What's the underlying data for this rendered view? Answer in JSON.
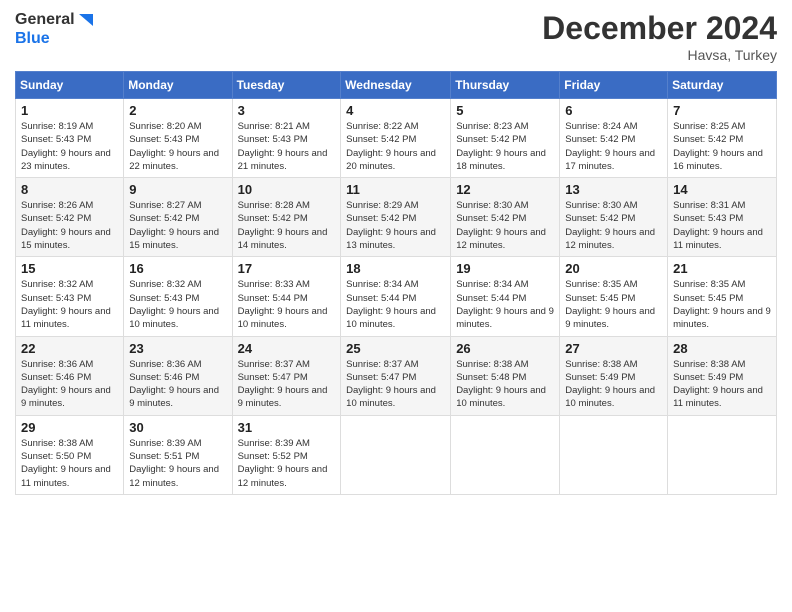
{
  "logo": {
    "line1": "General",
    "line2": "Blue"
  },
  "title": "December 2024",
  "location": "Havsa, Turkey",
  "days_header": [
    "Sunday",
    "Monday",
    "Tuesday",
    "Wednesday",
    "Thursday",
    "Friday",
    "Saturday"
  ],
  "weeks": [
    [
      {
        "day": "1",
        "sunrise": "8:19 AM",
        "sunset": "5:43 PM",
        "daylight": "9 hours and 23 minutes."
      },
      {
        "day": "2",
        "sunrise": "8:20 AM",
        "sunset": "5:43 PM",
        "daylight": "9 hours and 22 minutes."
      },
      {
        "day": "3",
        "sunrise": "8:21 AM",
        "sunset": "5:43 PM",
        "daylight": "9 hours and 21 minutes."
      },
      {
        "day": "4",
        "sunrise": "8:22 AM",
        "sunset": "5:42 PM",
        "daylight": "9 hours and 20 minutes."
      },
      {
        "day": "5",
        "sunrise": "8:23 AM",
        "sunset": "5:42 PM",
        "daylight": "9 hours and 18 minutes."
      },
      {
        "day": "6",
        "sunrise": "8:24 AM",
        "sunset": "5:42 PM",
        "daylight": "9 hours and 17 minutes."
      },
      {
        "day": "7",
        "sunrise": "8:25 AM",
        "sunset": "5:42 PM",
        "daylight": "9 hours and 16 minutes."
      }
    ],
    [
      {
        "day": "8",
        "sunrise": "8:26 AM",
        "sunset": "5:42 PM",
        "daylight": "9 hours and 15 minutes."
      },
      {
        "day": "9",
        "sunrise": "8:27 AM",
        "sunset": "5:42 PM",
        "daylight": "9 hours and 15 minutes."
      },
      {
        "day": "10",
        "sunrise": "8:28 AM",
        "sunset": "5:42 PM",
        "daylight": "9 hours and 14 minutes."
      },
      {
        "day": "11",
        "sunrise": "8:29 AM",
        "sunset": "5:42 PM",
        "daylight": "9 hours and 13 minutes."
      },
      {
        "day": "12",
        "sunrise": "8:30 AM",
        "sunset": "5:42 PM",
        "daylight": "9 hours and 12 minutes."
      },
      {
        "day": "13",
        "sunrise": "8:30 AM",
        "sunset": "5:42 PM",
        "daylight": "9 hours and 12 minutes."
      },
      {
        "day": "14",
        "sunrise": "8:31 AM",
        "sunset": "5:43 PM",
        "daylight": "9 hours and 11 minutes."
      }
    ],
    [
      {
        "day": "15",
        "sunrise": "8:32 AM",
        "sunset": "5:43 PM",
        "daylight": "9 hours and 11 minutes."
      },
      {
        "day": "16",
        "sunrise": "8:32 AM",
        "sunset": "5:43 PM",
        "daylight": "9 hours and 10 minutes."
      },
      {
        "day": "17",
        "sunrise": "8:33 AM",
        "sunset": "5:44 PM",
        "daylight": "9 hours and 10 minutes."
      },
      {
        "day": "18",
        "sunrise": "8:34 AM",
        "sunset": "5:44 PM",
        "daylight": "9 hours and 10 minutes."
      },
      {
        "day": "19",
        "sunrise": "8:34 AM",
        "sunset": "5:44 PM",
        "daylight": "9 hours and 9 minutes."
      },
      {
        "day": "20",
        "sunrise": "8:35 AM",
        "sunset": "5:45 PM",
        "daylight": "9 hours and 9 minutes."
      },
      {
        "day": "21",
        "sunrise": "8:35 AM",
        "sunset": "5:45 PM",
        "daylight": "9 hours and 9 minutes."
      }
    ],
    [
      {
        "day": "22",
        "sunrise": "8:36 AM",
        "sunset": "5:46 PM",
        "daylight": "9 hours and 9 minutes."
      },
      {
        "day": "23",
        "sunrise": "8:36 AM",
        "sunset": "5:46 PM",
        "daylight": "9 hours and 9 minutes."
      },
      {
        "day": "24",
        "sunrise": "8:37 AM",
        "sunset": "5:47 PM",
        "daylight": "9 hours and 9 minutes."
      },
      {
        "day": "25",
        "sunrise": "8:37 AM",
        "sunset": "5:47 PM",
        "daylight": "9 hours and 10 minutes."
      },
      {
        "day": "26",
        "sunrise": "8:38 AM",
        "sunset": "5:48 PM",
        "daylight": "9 hours and 10 minutes."
      },
      {
        "day": "27",
        "sunrise": "8:38 AM",
        "sunset": "5:49 PM",
        "daylight": "9 hours and 10 minutes."
      },
      {
        "day": "28",
        "sunrise": "8:38 AM",
        "sunset": "5:49 PM",
        "daylight": "9 hours and 11 minutes."
      }
    ],
    [
      {
        "day": "29",
        "sunrise": "8:38 AM",
        "sunset": "5:50 PM",
        "daylight": "9 hours and 11 minutes."
      },
      {
        "day": "30",
        "sunrise": "8:39 AM",
        "sunset": "5:51 PM",
        "daylight": "9 hours and 12 minutes."
      },
      {
        "day": "31",
        "sunrise": "8:39 AM",
        "sunset": "5:52 PM",
        "daylight": "9 hours and 12 minutes."
      },
      null,
      null,
      null,
      null
    ]
  ]
}
